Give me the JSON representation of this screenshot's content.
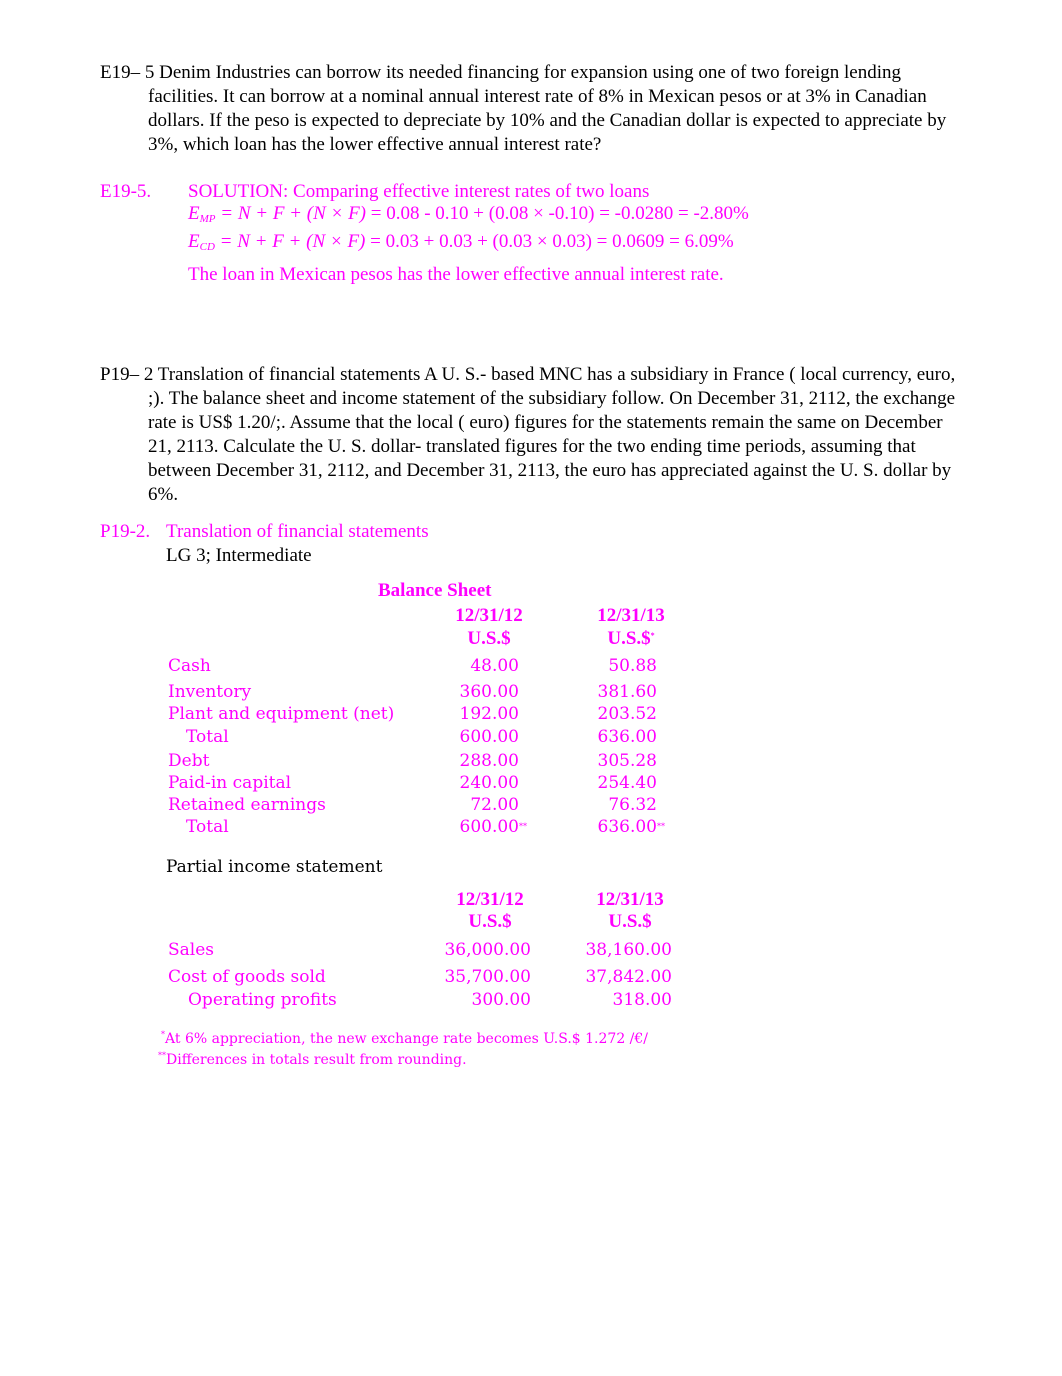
{
  "exercise": {
    "label": "E19– 5",
    "text": "Denim Industries can borrow its needed financing for expansion using one of two foreign lending facilities. It can borrow at a nominal annual interest rate of 8% in Mexican pesos or at 3% in Canadian dollars. If the peso is expected to depreciate by 10% and the Canadian dollar is expected to appreciate by 3%, which loan has the lower effective annual interest rate?"
  },
  "solution": {
    "label": "E19-5.",
    "title": "SOLUTION:  Comparing effective interest rates of two loans",
    "equations": [
      {
        "var": "E",
        "sub": "MP",
        "formula": "= N  + F  + (N × F)",
        "calc": "= 0.08 - 0.10  + (0.08 × -0.10) = -0.0280 = -2.80%"
      },
      {
        "var": "E",
        "sub": "CD",
        "formula": "= N  + F  + (N × F)",
        "calc": "= 0.03  + 0.03  + (0.03 × 0.03) = 0.0609 = 6.09%"
      }
    ],
    "conclusion": "The loan in Mexican pesos has the lower effective annual interest rate."
  },
  "problem": {
    "label": "P19– 2",
    "text": "Translation of financial statements A U. S.- based MNC has a subsidiary in France ( local currency, euro, ;). The balance sheet and income statement of the subsidiary follow. On December 31, 2112, the exchange rate is US$ 1.20/;. Assume that the local ( euro) figures for the statements remain the same on December 21, 2113. Calculate the U. S. dollar- translated figures for the two ending time periods, assuming that between December 31, 2112, and December 31, 2113, the euro has appreciated against the U. S. dollar by 6%."
  },
  "answer": {
    "label": "P19-2.",
    "title": "Translation of financial statements",
    "subtitle": "LG 3; Intermediate",
    "balance_sheet": {
      "title": "Balance Sheet",
      "columns": [
        {
          "date": "12/31/12",
          "currency": "U.S.$",
          "mark": ""
        },
        {
          "date": "12/31/13",
          "currency": "U.S.$",
          "mark": "*"
        }
      ],
      "rows": [
        {
          "label": "Cash",
          "indent": false,
          "v1": "48.00",
          "v2": "50.88",
          "mark": ""
        },
        {
          "label": "Inventory",
          "indent": false,
          "v1": "360.00",
          "v2": "381.60",
          "mark": ""
        },
        {
          "label": "Plant and equipment (net)",
          "indent": false,
          "v1": "192.00",
          "v2": "203.52",
          "mark": ""
        },
        {
          "label": "Total",
          "indent": true,
          "v1": "600.00",
          "v2": "636.00",
          "mark": ""
        },
        {
          "label": "Debt",
          "indent": false,
          "v1": "288.00",
          "v2": "305.28",
          "mark": ""
        },
        {
          "label": "Paid-in capital",
          "indent": false,
          "v1": "240.00",
          "v2": "254.40",
          "mark": ""
        },
        {
          "label": "Retained earnings",
          "indent": false,
          "v1": "72.00",
          "v2": "76.32",
          "mark": ""
        },
        {
          "label": "Total",
          "indent": true,
          "v1": "600.00",
          "v2": "636.00",
          "mark": "**"
        }
      ]
    },
    "income_statement": {
      "title": "Partial income statement",
      "columns": [
        {
          "date": "12/31/12",
          "currency": "U.S.$"
        },
        {
          "date": "12/31/13",
          "currency": "U.S.$"
        }
      ],
      "rows": [
        {
          "label": "Sales",
          "indent": false,
          "v1": "36,000.00",
          "v2": "38,160.00"
        },
        {
          "label": "Cost of goods sold",
          "indent": false,
          "v1": "35,700.00",
          "v2": "37,842.00"
        },
        {
          "label": "Operating profits",
          "indent": true,
          "v1": "300.00",
          "v2": "318.00"
        }
      ]
    },
    "footnotes": [
      {
        "mark": "*",
        "text": "At 6% appreciation, the new exchange rate becomes U.S.$ 1.272 /€/"
      },
      {
        "mark": "**",
        "text": "Differences in totals result from rounding."
      }
    ]
  }
}
